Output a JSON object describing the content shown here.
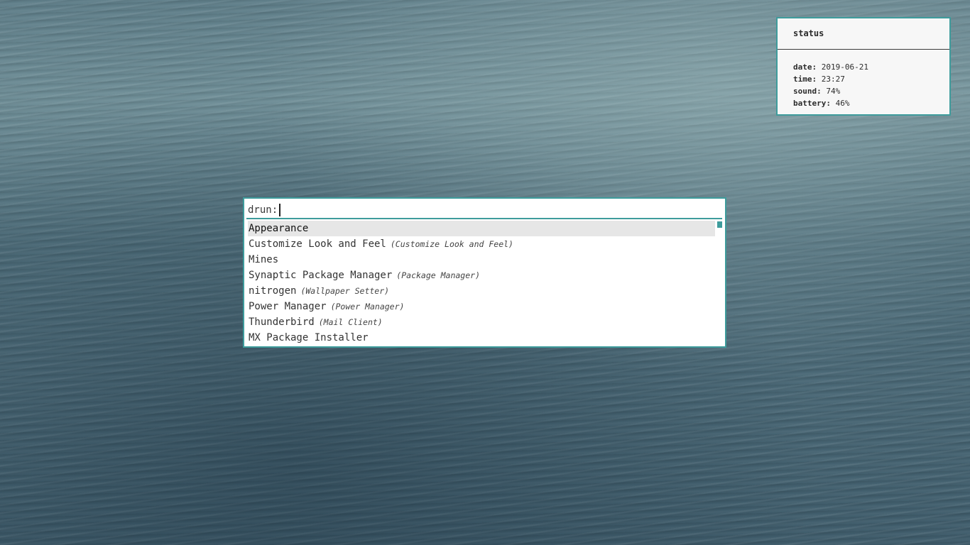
{
  "status": {
    "title": "status",
    "lines": [
      {
        "key": "date:",
        "value": "2019-06-21"
      },
      {
        "key": "time:",
        "value": "23:27"
      },
      {
        "key": "sound:",
        "value": "74%"
      },
      {
        "key": "battery:",
        "value": "46%"
      }
    ]
  },
  "launcher": {
    "prompt": "drun:",
    "input_value": "",
    "items": [
      {
        "name": "Appearance",
        "desc": ""
      },
      {
        "name": "Customize Look and Feel",
        "desc": "(Customize Look and Feel)"
      },
      {
        "name": "Mines",
        "desc": ""
      },
      {
        "name": "Synaptic Package Manager",
        "desc": "(Package Manager)"
      },
      {
        "name": "nitrogen",
        "desc": "(Wallpaper Setter)"
      },
      {
        "name": "Power Manager",
        "desc": "(Power Manager)"
      },
      {
        "name": "Thunderbird",
        "desc": "(Mail Client)"
      },
      {
        "name": "MX Package Installer",
        "desc": ""
      }
    ],
    "selected_index": 0
  },
  "colors": {
    "accent": "#3e9c9c",
    "selected_bg": "#e6e6e6"
  }
}
